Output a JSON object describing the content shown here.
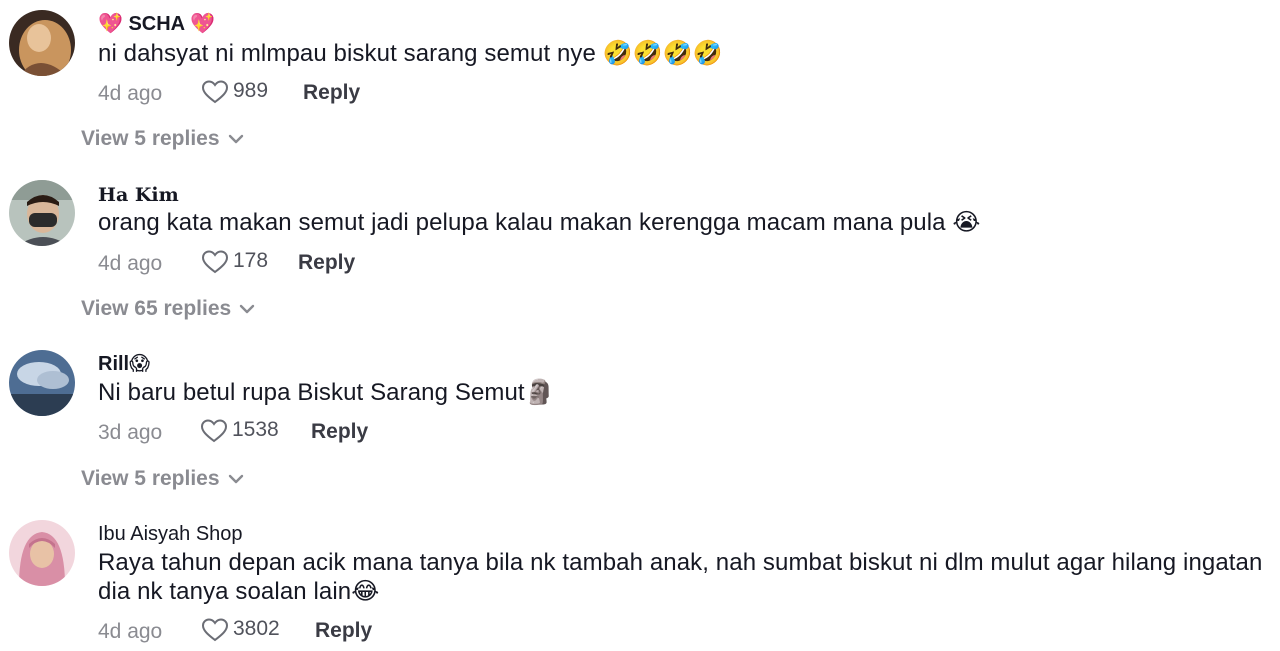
{
  "comments": [
    {
      "username": "💖 SCHA 💖",
      "text": "ni dahsyat ni mlmpau biskut sarang semut nye 🤣🤣🤣🤣",
      "time": "4d ago",
      "likes": "989",
      "reply_label": "Reply",
      "view_replies": "View 5 replies",
      "avatar_color": "#c9a27a"
    },
    {
      "username": "Ha Kim",
      "text": "orang kata makan semut jadi pelupa kalau makan kerengga macam mana pula 😭",
      "time": "4d ago",
      "likes": "178",
      "reply_label": "Reply",
      "view_replies": "View 65 replies",
      "avatar_color": "#9aa7a0"
    },
    {
      "username": "Rill😱",
      "text": "Ni baru betul rupa Biskut Sarang Semut🗿",
      "time": "3d ago",
      "likes": "1538",
      "reply_label": "Reply",
      "view_replies": "View 5 replies",
      "avatar_color": "#5f7fa6"
    },
    {
      "username": "Ibu Aisyah Shop",
      "text": "Raya tahun depan acik mana tanya bila nk tambah anak, nah sumbat biskut ni dlm mulut agar hilang ingatan dia nk tanya soalan lain😂",
      "time": "4d ago",
      "likes": "3802",
      "reply_label": "Reply",
      "avatar_color": "#e2a9b9"
    }
  ],
  "icons": {
    "like": "heart-outline-icon",
    "expand": "chevron-down-icon"
  },
  "colors": {
    "text_primary": "#161823",
    "text_secondary": "#8a8b91"
  }
}
